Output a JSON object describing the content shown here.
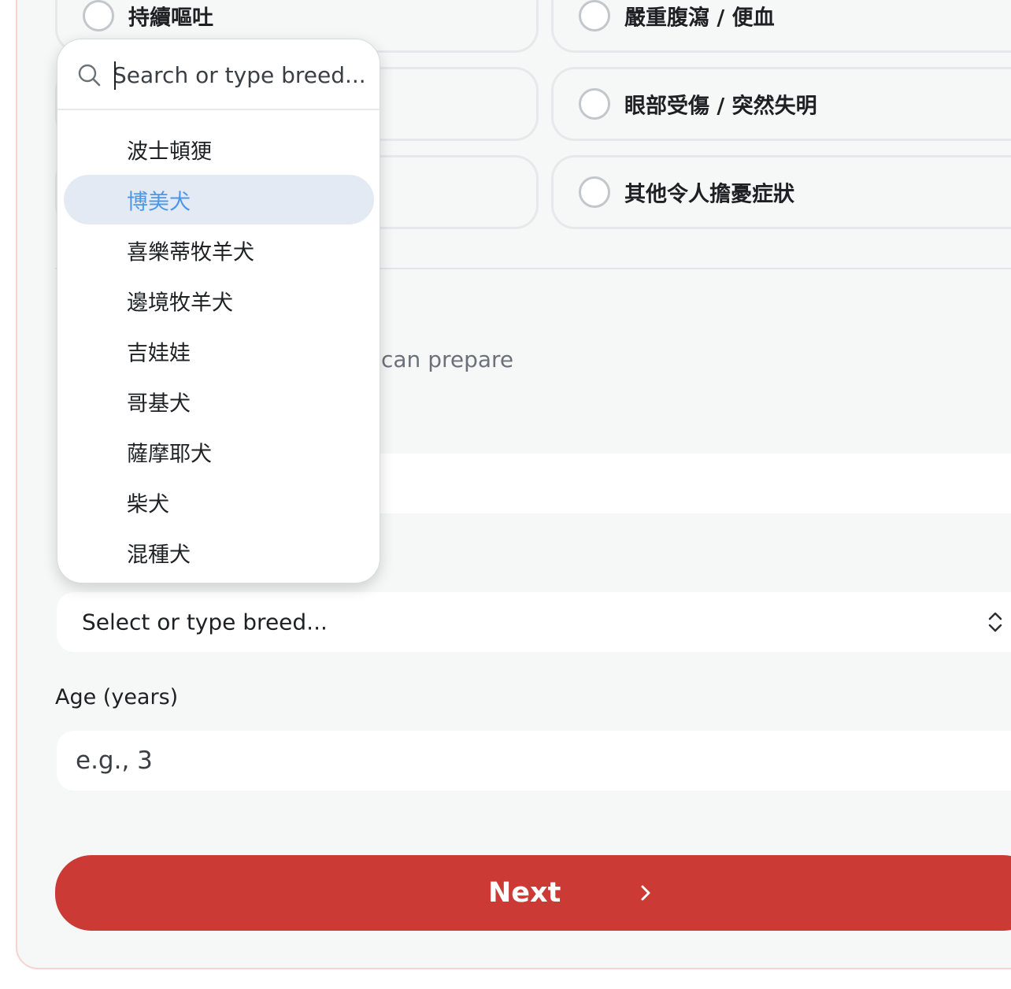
{
  "symptoms": [
    {
      "label": "持續嘔吐"
    },
    {
      "label": "嚴重腹瀉 / 便血"
    },
    {
      "label": "眼部受傷 / 突然失明"
    },
    {
      "label": "其他令人擔憂症狀"
    }
  ],
  "hint_text": "can prepare",
  "breed": {
    "select_placeholder": "Select or type breed...",
    "search_placeholder": "Search or type breed...",
    "options": [
      {
        "label": "波士頓㹴",
        "highlighted": false
      },
      {
        "label": "博美犬",
        "highlighted": true
      },
      {
        "label": "喜樂蒂牧羊犬",
        "highlighted": false
      },
      {
        "label": "邊境牧羊犬",
        "highlighted": false
      },
      {
        "label": "吉娃娃",
        "highlighted": false
      },
      {
        "label": "哥基犬",
        "highlighted": false
      },
      {
        "label": "薩摩耶犬",
        "highlighted": false
      },
      {
        "label": "柴犬",
        "highlighted": false
      },
      {
        "label": "混種犬",
        "highlighted": false
      }
    ]
  },
  "age": {
    "label": "Age (years)",
    "placeholder": "e.g., 3"
  },
  "next_button": {
    "label": "Next"
  },
  "colors": {
    "primary_red": "#cb3a34",
    "highlight_bg": "#e4eaf3",
    "highlight_text": "#4c97e8"
  }
}
